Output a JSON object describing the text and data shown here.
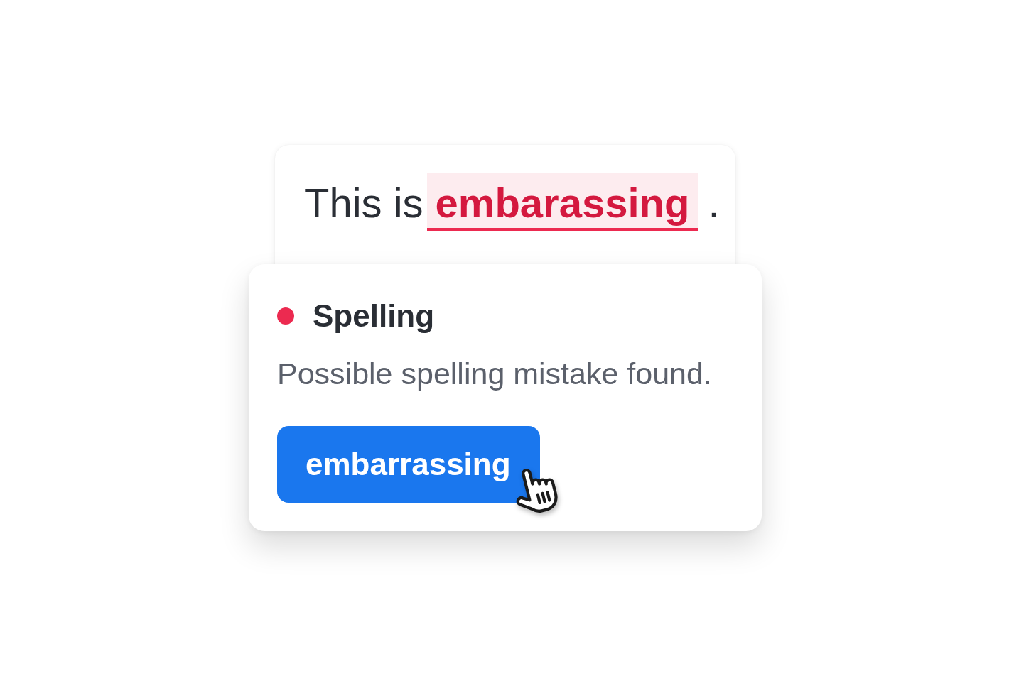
{
  "editor": {
    "text_before": "This is",
    "flagged_word": "embarassing",
    "text_after": "."
  },
  "issue_popup": {
    "category": "Spelling",
    "color": "#ec2a50",
    "message": "Possible spelling mistake found.",
    "suggestions": [
      {
        "label": "embarrassing",
        "hovered": true
      }
    ]
  }
}
